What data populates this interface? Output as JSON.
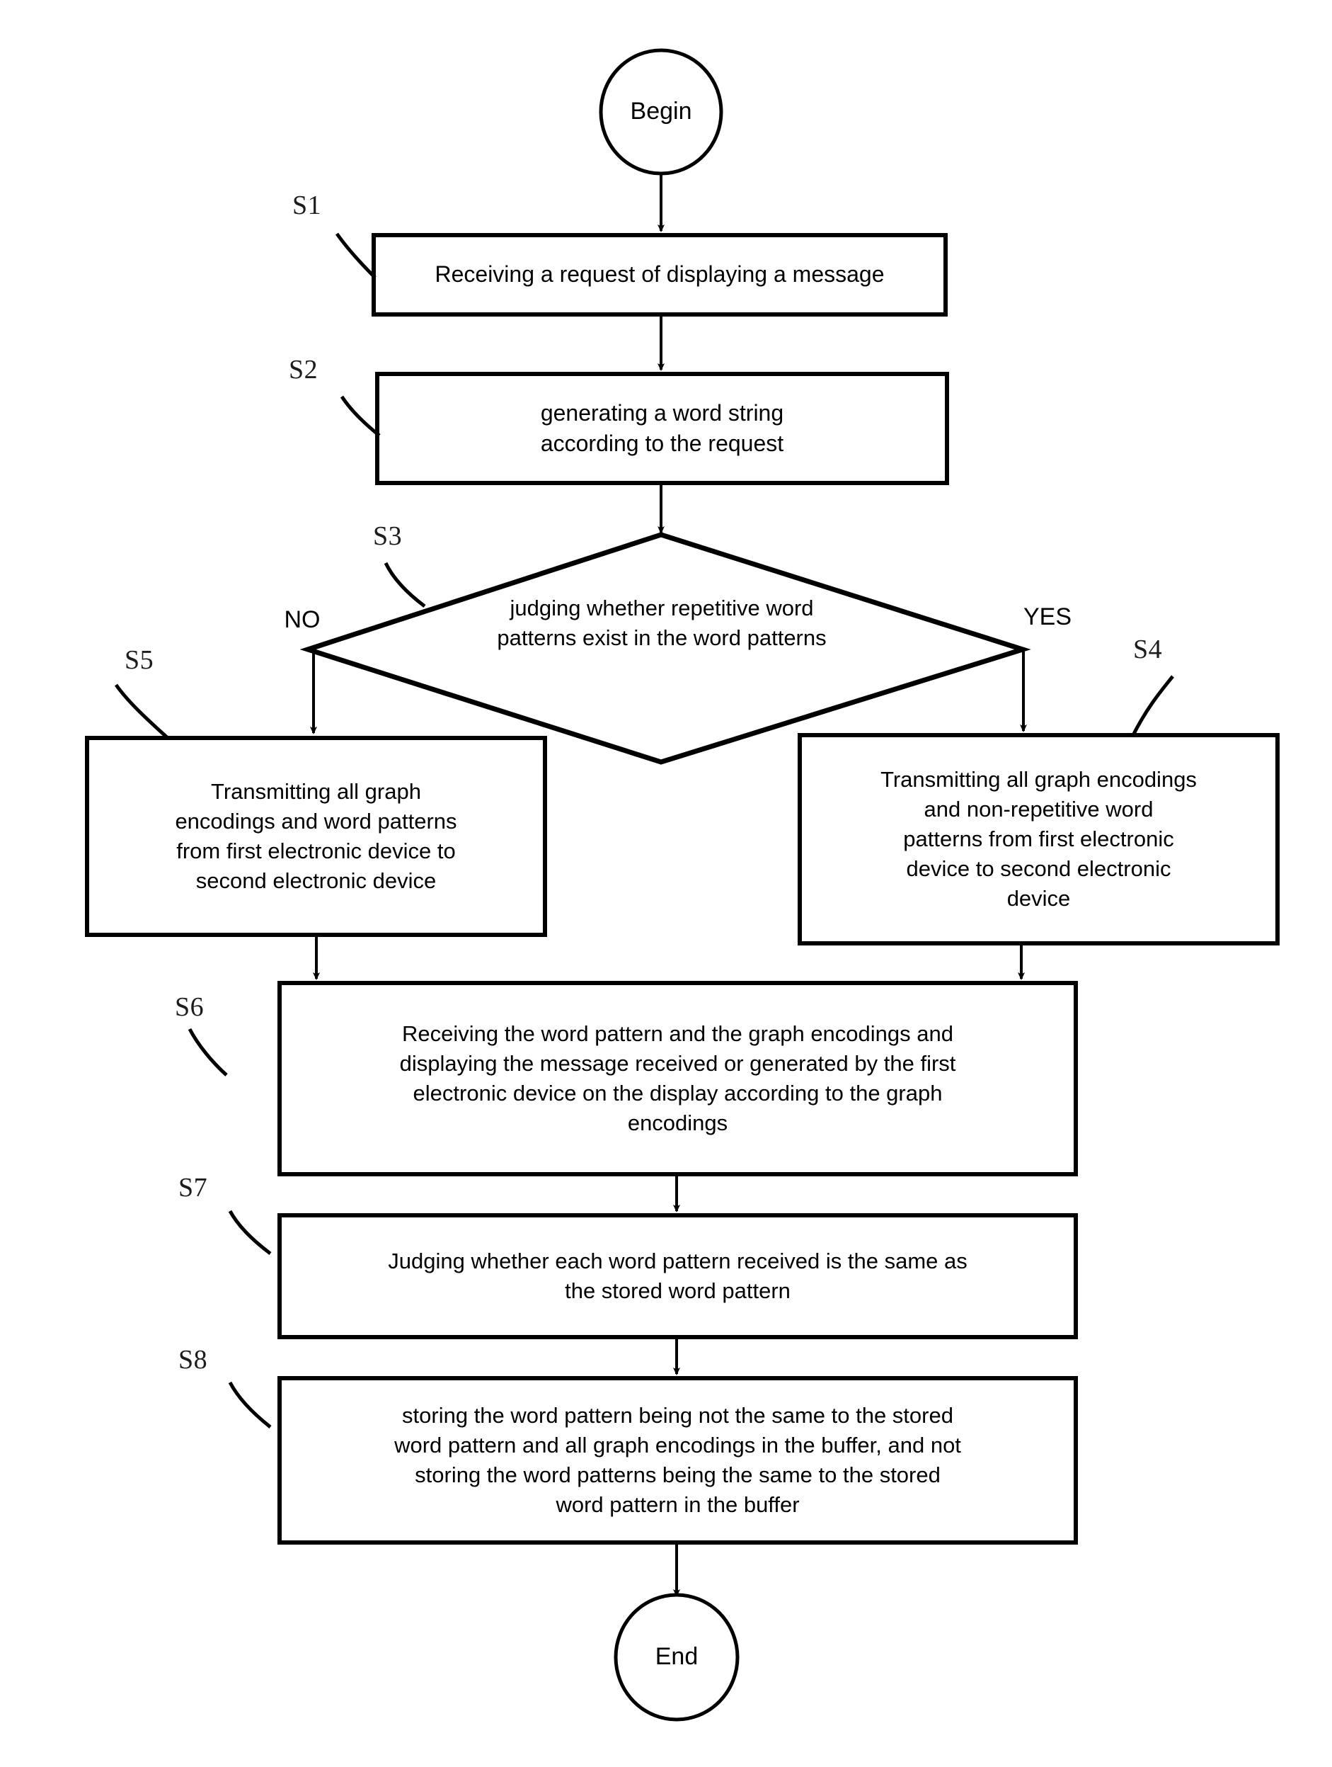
{
  "diagram": {
    "title": "Message display flowchart",
    "line_color": "#000000",
    "fill_color": "#ffffff",
    "text_color": "#000000"
  },
  "terminals": {
    "begin": "Begin",
    "end": "End"
  },
  "branch_labels": {
    "no": "NO",
    "yes": "YES"
  },
  "step_labels": {
    "s1": "S1",
    "s2": "S2",
    "s3": "S3",
    "s4": "S4",
    "s5": "S5",
    "s6": "S6",
    "s7": "S7",
    "s8": "S8"
  },
  "nodes": {
    "s1": "Receiving a request of displaying a message",
    "s2": "generating a word string\naccording to the request",
    "s3": "judging whether repetitive word\npatterns exist in the word patterns",
    "s4": "Transmitting all graph encodings\nand non-repetitive word\npatterns from first electronic\ndevice to second electronic\ndevice",
    "s5": "Transmitting all graph\nencodings and word patterns\nfrom first electronic device to\nsecond electronic device",
    "s6": "Receiving the word pattern and the graph encodings and\ndisplaying the message received or generated by the first\nelectronic device on the display according to the graph\nencodings",
    "s7": "Judging whether each word pattern received is the same as\nthe stored word pattern",
    "s8": "storing the word pattern being not the same to the stored\nword pattern and all graph encodings in the buffer, and not\nstoring the word patterns being the same to the stored\nword pattern in the buffer"
  }
}
